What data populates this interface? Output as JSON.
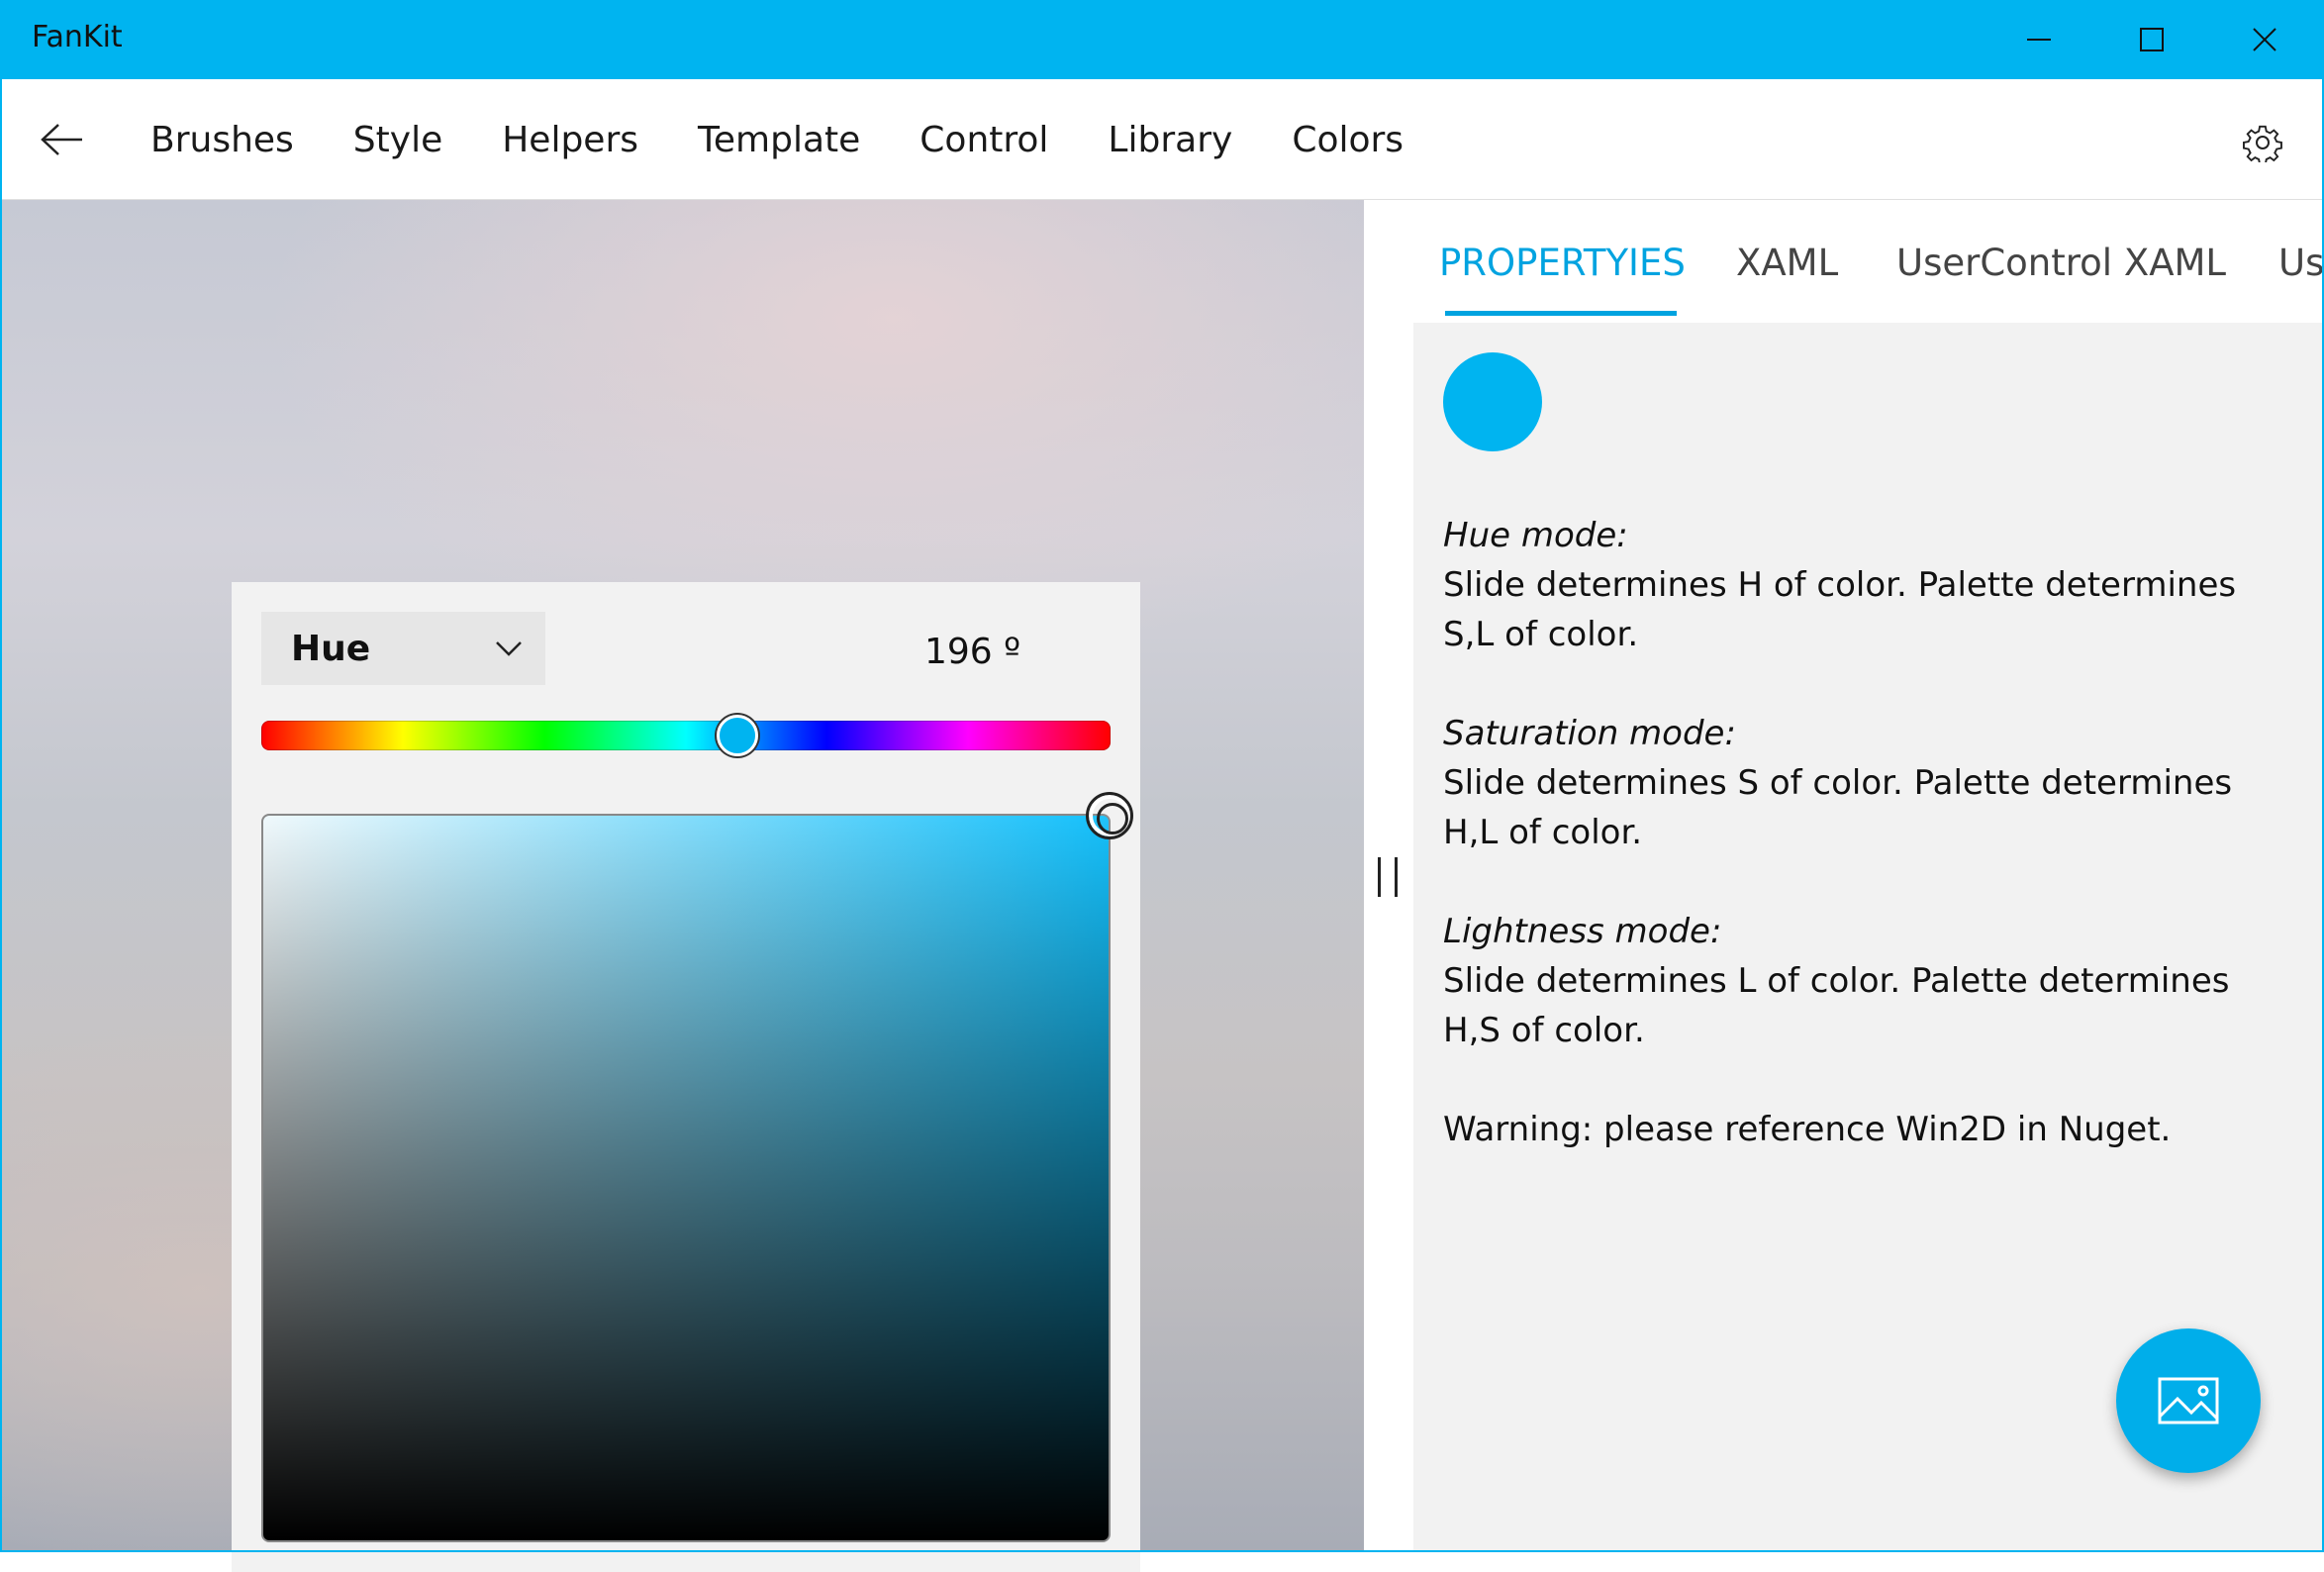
{
  "window": {
    "title": "FanKit"
  },
  "nav": {
    "items": [
      "Brushes",
      "Style",
      "Helpers",
      "Template",
      "Control",
      "Library",
      "Colors"
    ]
  },
  "picker": {
    "mode": "Hue",
    "value_text": "196 º",
    "hue_degrees": 196,
    "selected_color": "#00b4f0"
  },
  "tabs": {
    "items": [
      "PROPERTYIES",
      "XAML",
      "UserControl XAML",
      "Us"
    ],
    "active_index": 0
  },
  "properties": {
    "swatch_color": "#00b4f0",
    "hue_title": "Hue mode:",
    "hue_text": "Slide determines H of color. Palette determines S,L of color.",
    "saturation_title": "Saturation mode:",
    "saturation_text": "Slide determines S of color. Palette determines H,L of color.",
    "lightness_title": "Lightness mode:",
    "lightness_text": "Slide determines L of color. Palette determines H,S of color.",
    "warning": "Warning: please reference Win2D in Nuget."
  },
  "colors": {
    "accent": "#00b4f0",
    "tab_active": "#00a3e0"
  },
  "icons": {
    "back": "back-arrow-icon",
    "settings": "gear-icon",
    "fab": "image-icon",
    "minimize": "minimize-icon",
    "maximize": "maximize-icon",
    "close": "close-icon",
    "dropdown": "chevron-down-icon"
  }
}
